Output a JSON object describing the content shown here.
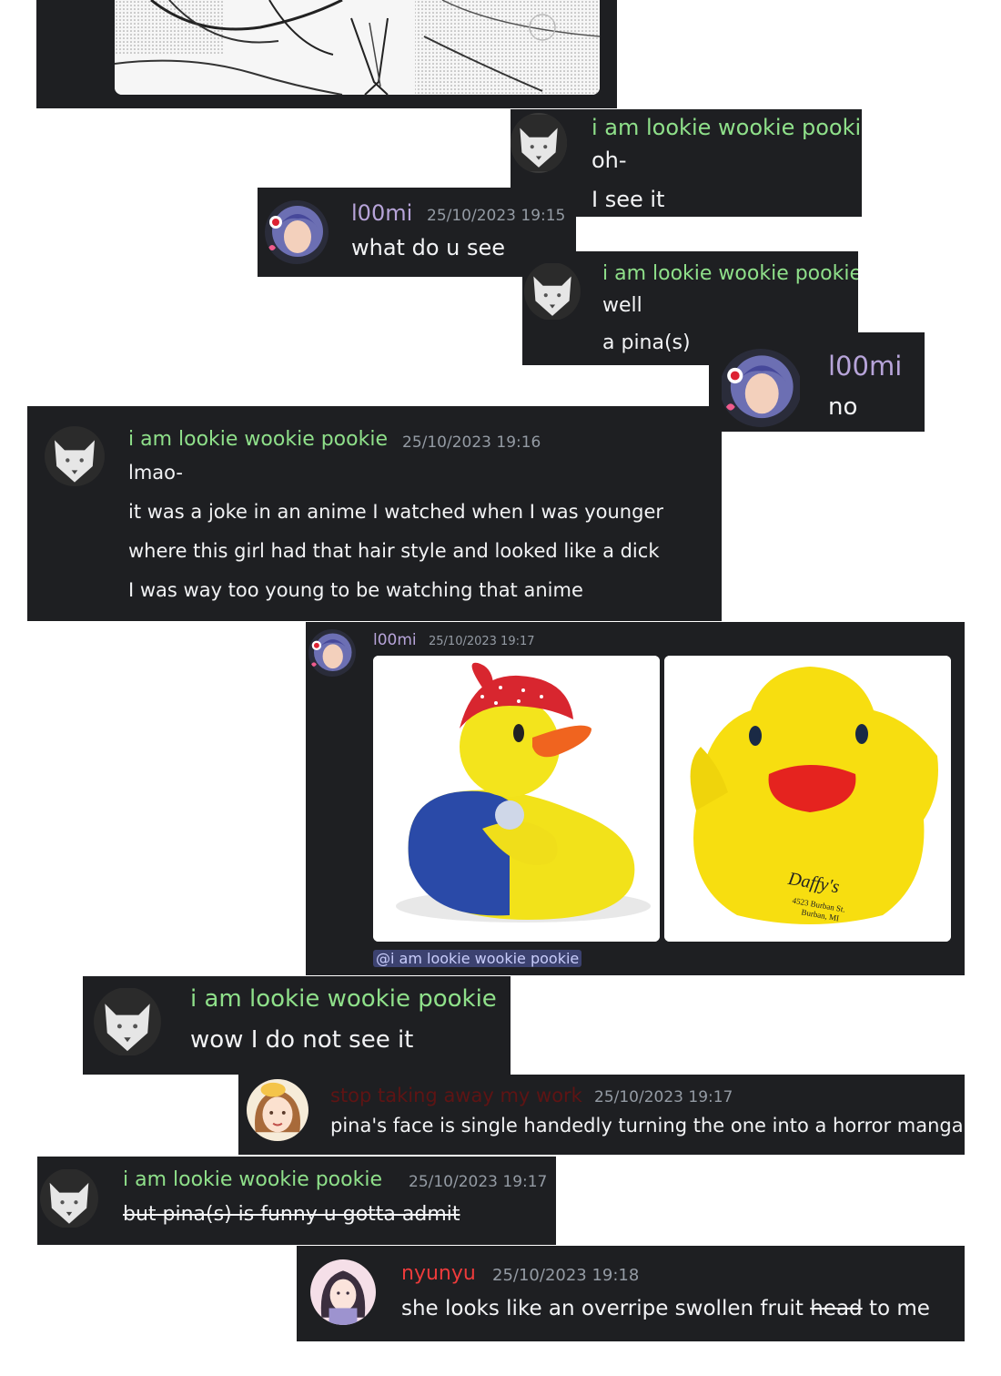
{
  "colors": {
    "card_bg": "#1e1f22",
    "text": "#f2f3f5",
    "timestamp": "#949ba4",
    "user_green": "#8fe08a",
    "user_purple": "#b7a4d9",
    "user_red": "#ed3b3b",
    "user_darkred": "#5e1414",
    "mention_bg": "#3c4270"
  },
  "crops": [
    {
      "id": "c2",
      "user": "i am lookie wookie pookie",
      "lines": [
        "oh-",
        "I see it"
      ]
    },
    {
      "id": "c3",
      "user": "l00mi",
      "timestamp": "25/10/2023 19:15",
      "lines": [
        "what do u see"
      ]
    },
    {
      "id": "c4",
      "user": "i am lookie wookie pookie",
      "lines": [
        "well",
        "a pina(s)"
      ]
    },
    {
      "id": "c5",
      "user": "l00mi",
      "lines": [
        "no"
      ]
    },
    {
      "id": "c6",
      "user": "i am lookie wookie pookie",
      "timestamp": "25/10/2023 19:16",
      "lines": [
        "lmao-",
        "it was a joke in an anime I watched when I was younger",
        "where this girl had that hair style and looked like a dick",
        "I was way too young to be watching that anime"
      ]
    },
    {
      "id": "c7",
      "user": "l00mi",
      "timestamp": "25/10/2023 19:17",
      "attachments": [
        "rubber-duck-with-red-bandana-image",
        "yellow-rubber-duck-daffys-image"
      ],
      "duck_print": [
        "Daffy's",
        "4523 Burban St.",
        "Burban, MI"
      ],
      "mention": "@i am lookie wookie pookie"
    },
    {
      "id": "c8",
      "user": "i am lookie wookie pookie",
      "lines": [
        "wow I do not see it"
      ]
    },
    {
      "id": "c9",
      "user": "stop taking away my work",
      "timestamp": "25/10/2023 19:17",
      "lines": [
        "pina's face is single handedly turning the one into a horror manga"
      ]
    },
    {
      "id": "c10",
      "user": "i am lookie wookie pookie",
      "timestamp": "25/10/2023 19:17",
      "lines": [
        "but pina(s) is funny u gotta admit"
      ]
    },
    {
      "id": "c11",
      "user": "nyunyu",
      "timestamp": "25/10/2023 19:18",
      "text_before": "she looks like an overripe swollen fruit ",
      "text_strike": "head",
      "text_after": " to me"
    }
  ]
}
